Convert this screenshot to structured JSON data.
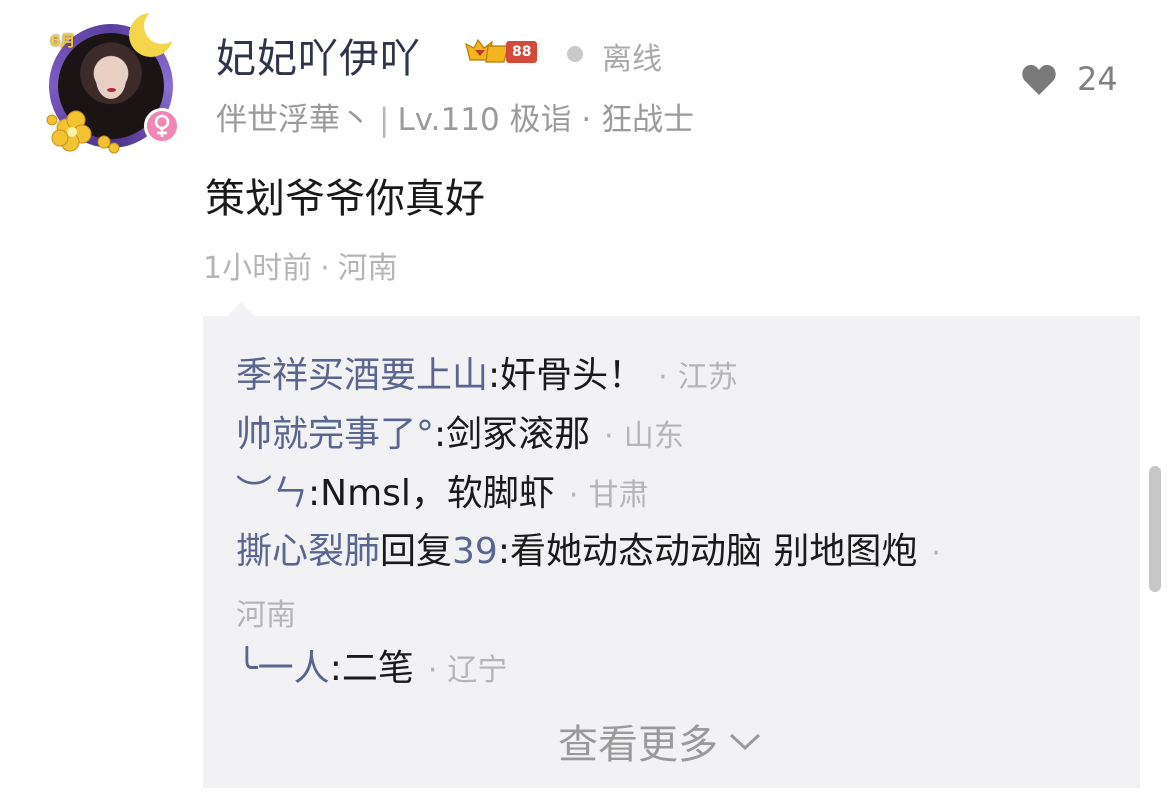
{
  "post": {
    "username": "妃妃吖伊吖",
    "level_badge_number": "88",
    "online_status": "离线",
    "like_count": "24",
    "guild": "伴世浮華丶",
    "level_info": "Lv.110 极诣 · 狂战士",
    "avatar_month_badge": "6月",
    "content": "策划爷爷你真好",
    "time": "1小时前",
    "location": "河南"
  },
  "replies": [
    {
      "author": "季祥买酒要上山",
      "text": ":奸骨头！",
      "location": "江苏"
    },
    {
      "author": "帅就完事了°",
      "text": ":剑冢滚那",
      "location": "山东"
    },
    {
      "author": "︶ㄣ",
      "text": ":Nmsl，软脚虾",
      "location": "甘肃"
    },
    {
      "author": "撕心裂肺",
      "reply_word": "回复",
      "reply_target": "39",
      "text": ":看她动态动动脑 别地图炮",
      "location": "河南"
    },
    {
      "author": "╰一人",
      "text": ":二笔",
      "location": "辽宁"
    }
  ],
  "view_more": "查看更多",
  "colors": {
    "author_link": "#5a6690",
    "reply_bg": "#f2f2f4",
    "meta_gray": "#b5b5b5",
    "gender_badge": "#f286b4"
  },
  "icons": {
    "like": "heart-icon",
    "gender": "female-icon",
    "level": "crown-icon",
    "expand": "chevron-down-icon"
  }
}
